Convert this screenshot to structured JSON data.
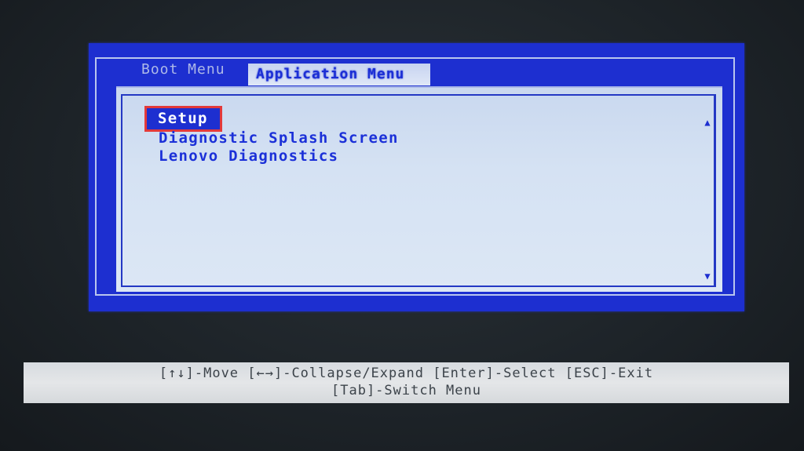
{
  "tabs": {
    "boot_menu": "Boot Menu",
    "application_menu": "Application Menu"
  },
  "menu": {
    "items": [
      {
        "label": "Setup"
      },
      {
        "label": "Diagnostic Splash Screen"
      },
      {
        "label": "Lenovo Diagnostics"
      }
    ]
  },
  "scroll": {
    "up_icon": "▲",
    "down_icon": "▼"
  },
  "status": {
    "line1": "[↑↓]-Move [←→]-Collapse/Expand [Enter]-Select [ESC]-Exit",
    "line2": "[Tab]-Switch Menu"
  },
  "colors": {
    "bios_blue": "#1d2fd0",
    "menu_background": "#d5e2f3",
    "highlight_border": "#e33a3a",
    "statusbar_background": "#e4e6e8"
  }
}
